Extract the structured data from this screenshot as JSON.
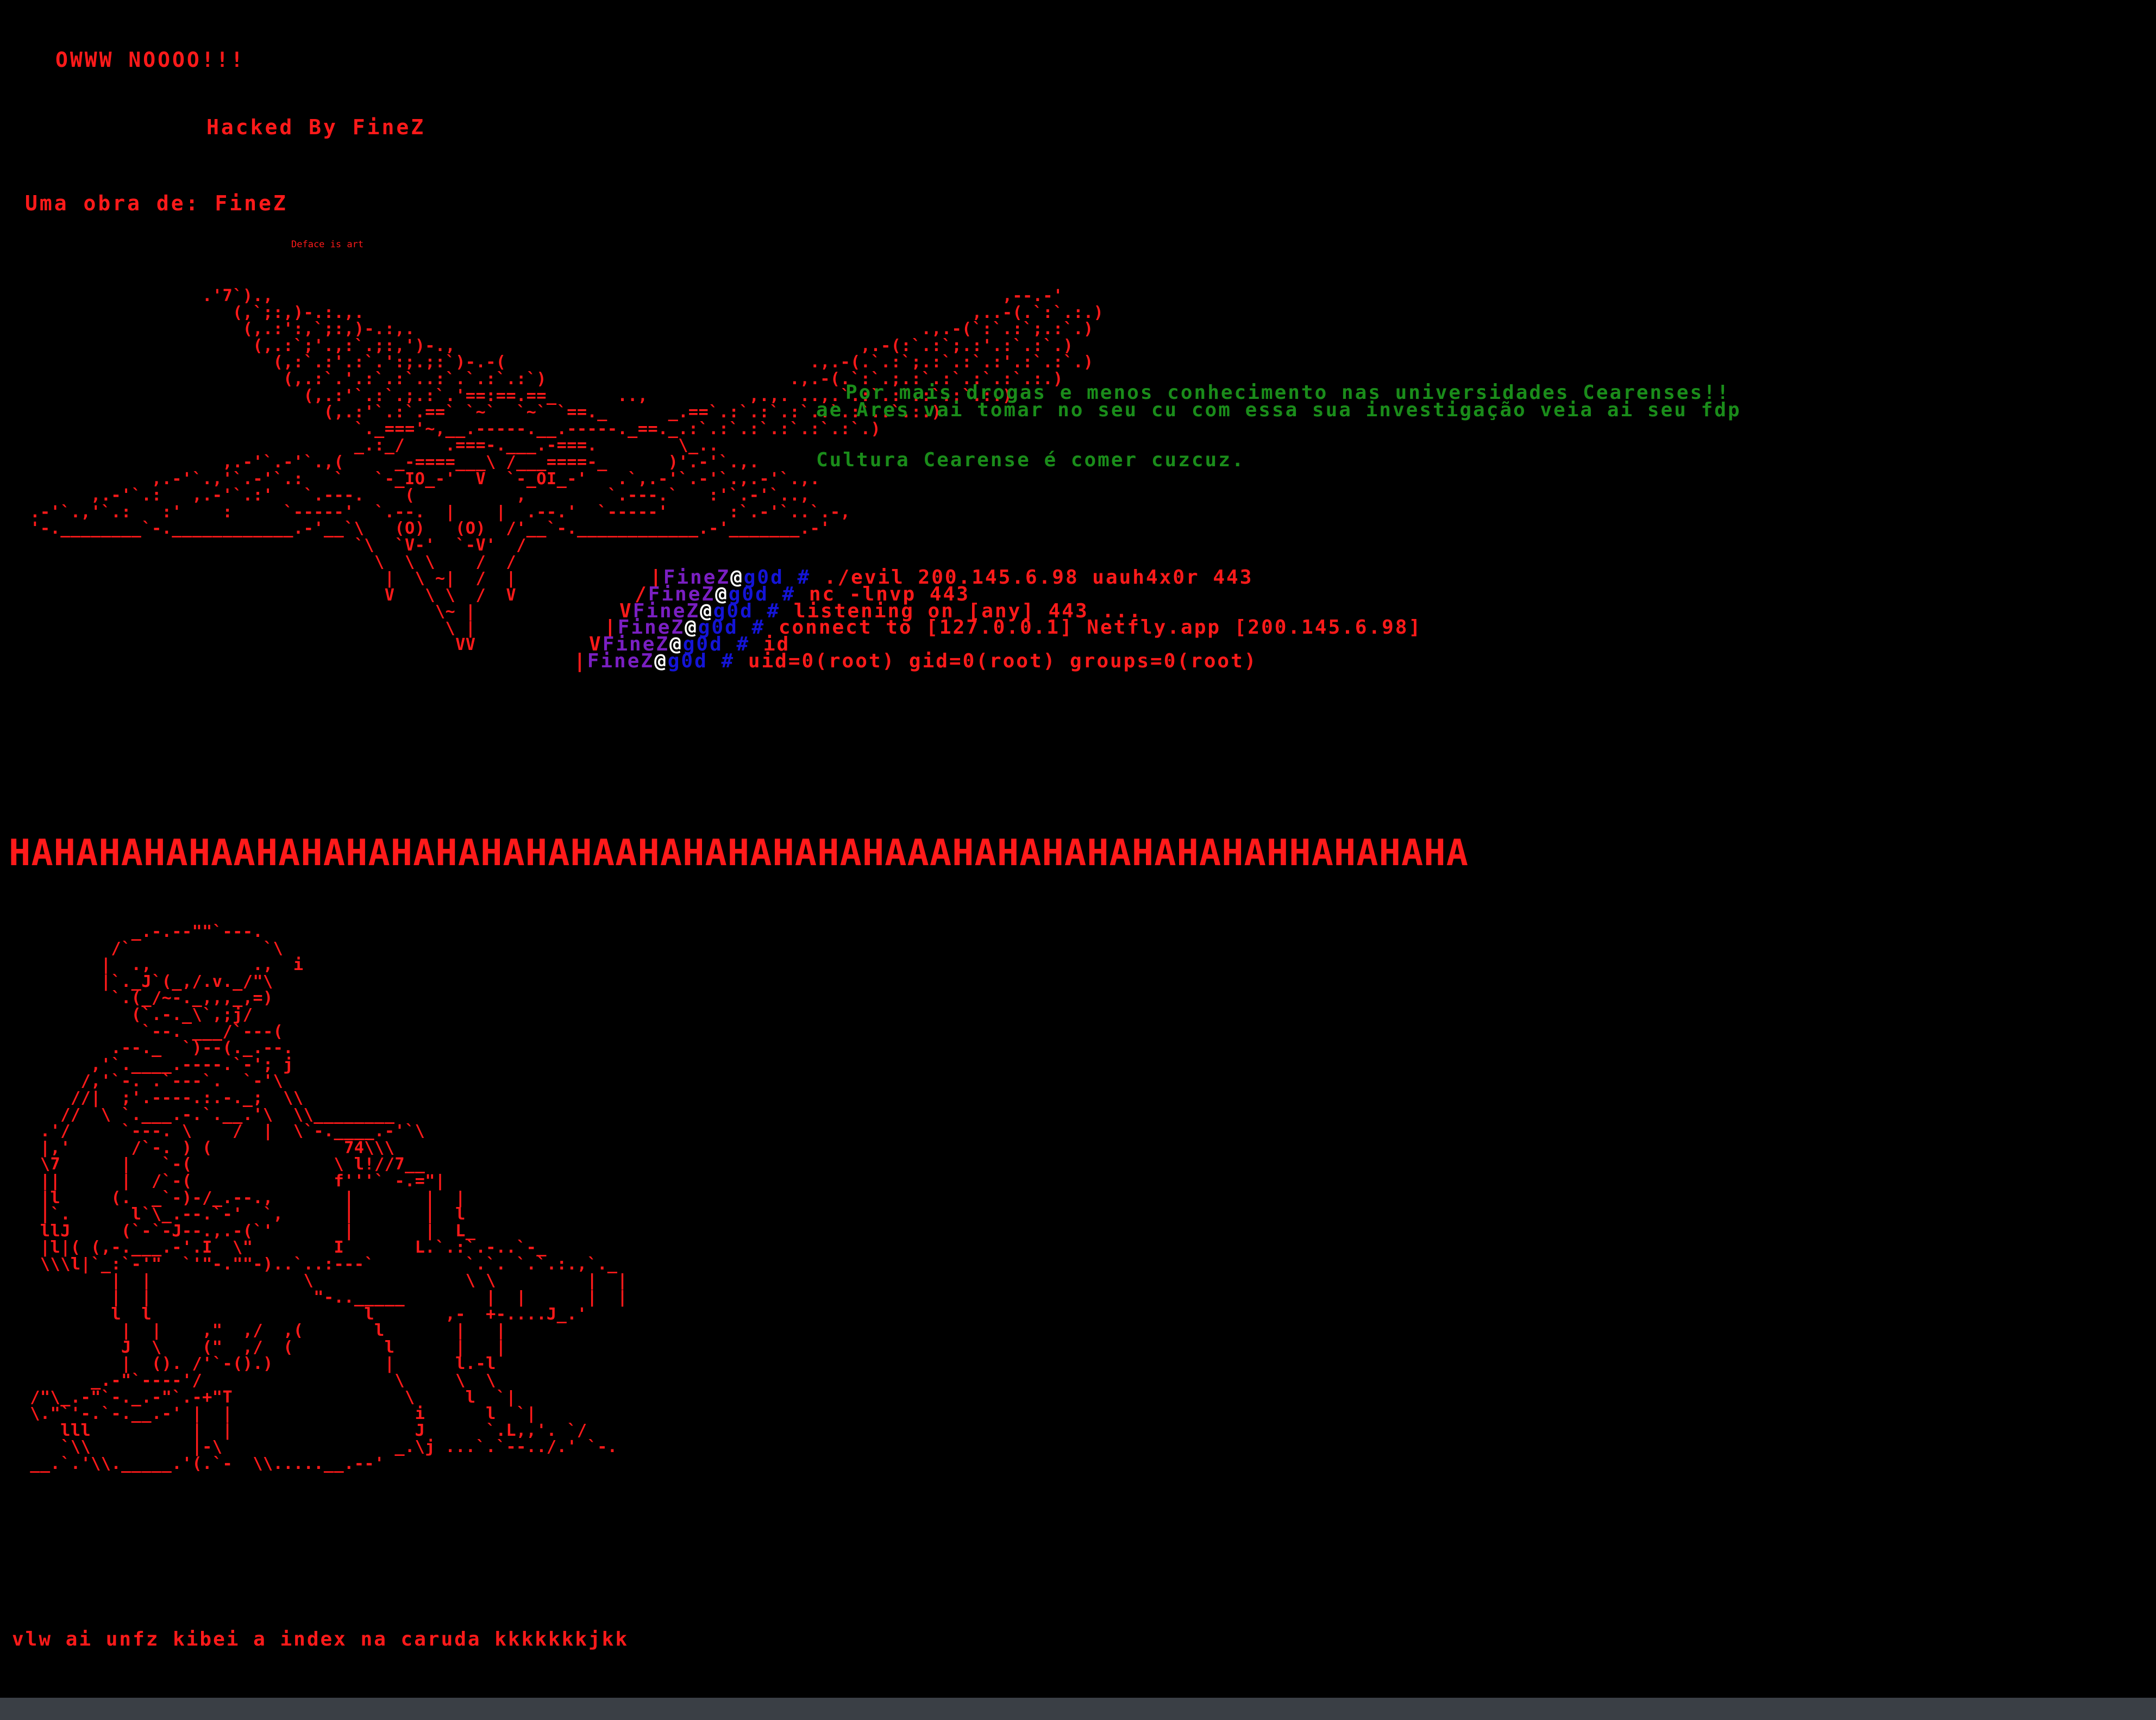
{
  "header": {
    "exclaim": "OWWW NOOOO!!!",
    "hacked_by": "Hacked By FineZ",
    "obra": "Uma obra de: FineZ",
    "deface": "Deface is art"
  },
  "messages": {
    "line1": "Por mais drogas e menos conhecimento nas universidades Cearenses!!",
    "line2": "ae Ares vai tomar no seu cu com essa sua investigação veia ai seu fdp",
    "line3": "Cultura Cearense é comer cuzcuz."
  },
  "terminal": {
    "user": "FineZ",
    "at": "@",
    "host": "g0d",
    "prompt": " # ",
    "lines": [
      "./evil 200.145.6.98 uauh4x0r 443",
      "nc -lnvp 443",
      "listening on [any] 443 ...",
      "connect to [127.0.0.1] Netfly.app [200.145.6.98]",
      "id",
      "uid=0(root) gid=0(root) groups=0(root)"
    ]
  },
  "laugh": "HAHAHAHAHAAHAHAHAHAHAHAHAHAAHAHAHAHAHAHAAAHAHAHAHAHAHAHAHHAHAHAHA",
  "footer": "vlw ai unfz kibei a index na caruda kkkkkkkjkk",
  "ascii": {
    "demon": "                   .'7`).,                                                                        ,--.-'\n                      (,`;:,)-.:.,.                                                            ,..-(.`:`.:.)\n                       (,.:':,`;:,)-.:,.                                                  .,.-(`:`.:`;.:`.)\n                        (,.:`;'.,:`.;:,')-.,                                        ,.-(:`.:`;.:'.:`.:`.)\n                          (,:`.:'.:`.':;.;:`)-.-(                              .,.-(.`.:`;.:`.:`.:'.:`.:`.)\n                           (,.:`.'.:`.:`..:`.`.:`.:`)                        .,.-(.`:`.;.:`.:`.:`.:`.:.)\n                             (,.:'`.:`.;.:`.'==:==.==_      ..,          ,.,. ..,.`.:`.:`.:`.:`.:.)\n                               (,.:'`.:`.==` `~`  `~` `==._      _.==`.:`.:`.:`.:`.:`.:`.:.)\n                                  `._==='~,__.-----.__.-----._==._.:`.:`.:`.:`.:`.:`.)\n                                  _.:_/    .===-.___.-===.        \\_..\n                     ,.-'`.-'`.,(     _-====___\\ /___====-_      )'.-'`.,.\n              ,.-'`.,'`.-'`.:   `   `-_IO_-'  V  `-_OI_-'   .`,.-'`.-'`.,.-'`.,.\n        ,.-'`.:   ,.-'`.:'   `.---.    (          ,        `.---.`   :'`.-'`..,\n  .-'`.,'`.:   :'    :     `-----'  `.--.  |    |  .--.'  `-----'      :`.-'`..`.-,\n  '-.________`-.____________.-'__`\\   (O)   (O)  /'__`-.____________.-'_______.-'\n                                  `\\  `V-'  `-V'  /\n                                    \\  \\ \\    /  /\n                                     |  \\ ~|  /  |\n                                     V   \\ \\  /  V\n                                          \\~ |\n                                           \\ |\n                                            VV",
    "skeleton": "            _.-.--\"\"`---.\n          /`             `\\\n         |  .,          .,  i\n         |`._J`(_,/.v._/\"\\\n          `.(_/~-._,,,_,=)\n            (`.-._\\`,;j/\n             `--. ___/`---(\n          .--._  `)--(._.--.\n        ,'`.____.----.`-'; j\n       /,'`-. .`---`.  `-'\\\n      //|  ;'.----.:.-._;  \\\\\n     //  \\ `.___.-.`.__.'\\  \\\\________\n   .'/     `---. \\    /  |  \\`-.____.-'`\\\n   |,'      /`-. ) (             74\\\\\\\n   \\7      |   `-(              \\ l!//7__\n   ||      |  /`-(              f'''` -.=\"|\n   |l     (.  _`-)-/_.--.,       |       |  |\n   |`.      l`\\_.--.`-'  `,      |       |  l\n   llJ     (`-`-J--.,.-(`'       |       |  L_\n   |l|( (,-.___.-'.I  \\\"        I       L.`.:`.-..`-_\n   \\\\\\l|`_:`-'\"  `'\"-.\"\"-)..`..:---`         `.`. `.`.:.,`._\n          |  |               \\               \\ \\         |  |\n          |  |                \"-.._____        |  |      |  |\n          l  l                     l       ,-  +-....J_.'\n           |  |    ,\"  ,/  ,(       l       |   |\n           J  \\    (\"  ,/  (         l      |   |\n           |  (). /'`-().)           |      l.-l\n        _.-\"`----'/                   \\     \\  \\\n  /\"\\_.-\"`-._.-\"`.-+\"T                 \\     l  `|\n  \\.\"`'-.`-.__.-' |  |                  i      l  `|\n     lll          |  |                  J      `.L,,'. `/\n     `\\\\          |-\\                 _.\\j ...`.`--../.' `-.\n  __.`.'\\\\._____.'(.`-  \\\\.....__.--'"
  },
  "colors": {
    "background": "#000000",
    "primary_red": "#ff1a1a",
    "message_green": "#1a8c1a",
    "terminal_user": "#7a1fc2",
    "terminal_host": "#1414d6",
    "terminal_at": "#ffffff",
    "bottom_bar": "#3a3f45"
  }
}
